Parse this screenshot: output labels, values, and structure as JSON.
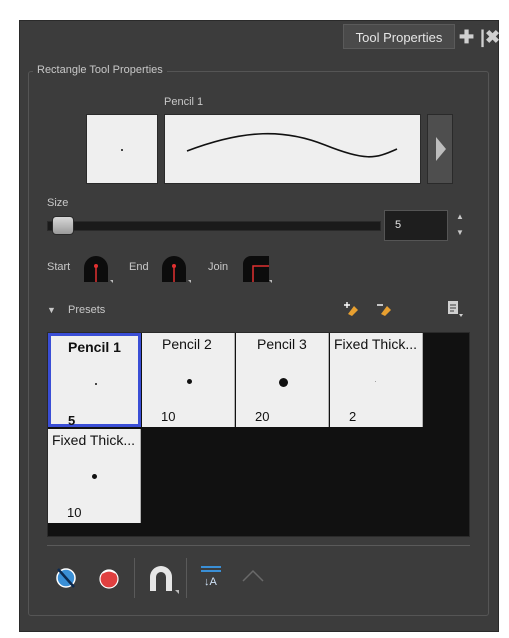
{
  "header": {
    "tab_label": "Tool Properties",
    "add_icon": "plus-icon",
    "close_icon": "close-icon"
  },
  "group_title": "Rectangle Tool Properties",
  "brush": {
    "name": "Pencil 1"
  },
  "size": {
    "label": "Size",
    "value": "5",
    "slider_fraction": 0.05
  },
  "caps": {
    "start_label": "Start",
    "end_label": "End",
    "join_label": "Join"
  },
  "presets": {
    "label": "Presets",
    "items": [
      {
        "name": "Pencil 1",
        "size": "5",
        "selected": true
      },
      {
        "name": "Pencil 2",
        "size": "10",
        "selected": false
      },
      {
        "name": "Pencil 3",
        "size": "20",
        "selected": false
      },
      {
        "name": "Fixed Thick...",
        "size": "2",
        "selected": false
      },
      {
        "name": "Fixed Thick...",
        "size": "10",
        "selected": false
      }
    ]
  },
  "colors": {
    "panel": "#3c3c3c",
    "selection": "#3a4ed6",
    "cap_marker": "#e03030",
    "accent_blue": "#3a8fd6"
  }
}
